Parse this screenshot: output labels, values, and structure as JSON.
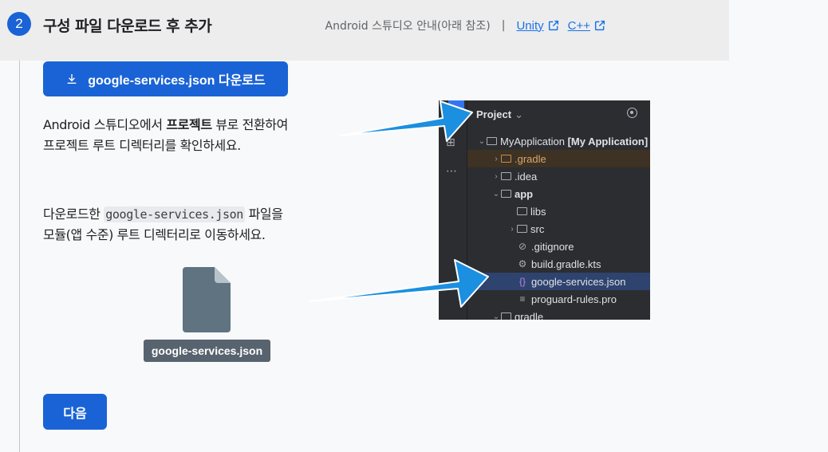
{
  "step": {
    "number": "2",
    "title": "구성 파일 다운로드 후 추가",
    "guide_text": "Android 스튜디오 안내(아래 참조)",
    "separator": "|",
    "links": [
      {
        "label": "Unity"
      },
      {
        "label": "C++"
      }
    ]
  },
  "download_button": {
    "label": "google-services.json 다운로드"
  },
  "instruction_1": {
    "line1_pre": "Android 스튜디오에서 ",
    "line1_bold": "프로젝트",
    "line1_post": " 뷰로 전환하여",
    "line2": "프로젝트 루트 디렉터리를 확인하세요."
  },
  "instruction_2": {
    "line1_pre": "다운로드한 ",
    "line1_code": "google-services.json",
    "line1_post": " 파일을",
    "line2": "모듈(앱 수준) 루트 디렉터리로 이동하세요."
  },
  "file_chip": {
    "label": "google-services.json"
  },
  "next_button": {
    "label": "다음"
  },
  "ide": {
    "panel_title": "Project",
    "tree": [
      {
        "label": "MyApplication",
        "suffix": "[My Application]"
      },
      {
        "label": ".gradle"
      },
      {
        "label": ".idea"
      },
      {
        "label": "app"
      },
      {
        "label": "libs"
      },
      {
        "label": "src"
      },
      {
        "label": ".gitignore"
      },
      {
        "label": "build.gradle.kts"
      },
      {
        "label": "google-services.json"
      },
      {
        "label": "proguard-rules.pro"
      },
      {
        "label": "gradle"
      }
    ]
  },
  "colors": {
    "accent": "#1a63d6",
    "link": "#1a73e8",
    "arrow": "#1b8fe0",
    "file_icon": "#5f7381",
    "chip": "#57636e"
  }
}
